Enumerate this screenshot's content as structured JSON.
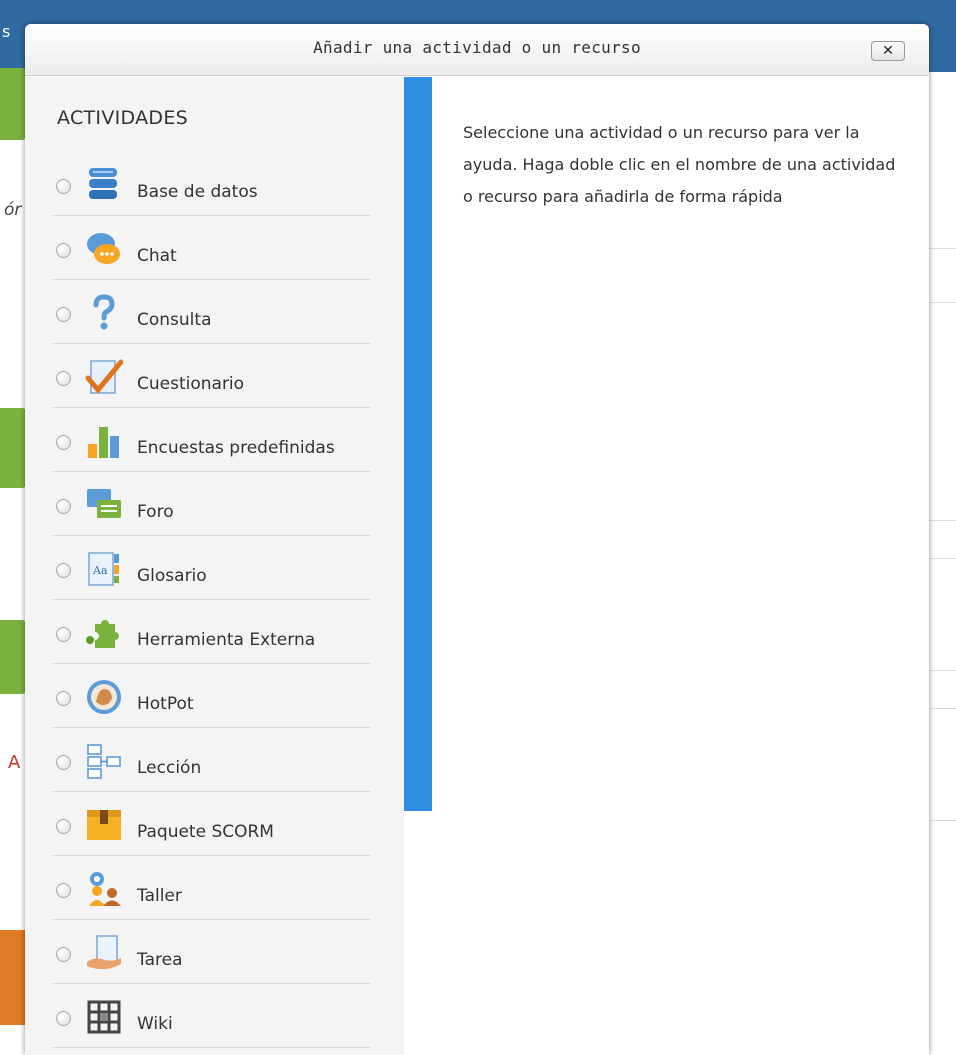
{
  "background": {
    "topbar_text": "s",
    "fragment_italic": "ór",
    "fragment_link": "A"
  },
  "dialog": {
    "title": "Añadir una actividad o un recurso",
    "close_label": "✕",
    "section_heading": "ACTIVIDADES",
    "help_text": "Seleccione una actividad o un recurso para ver la ayuda. Haga doble clic en el nombre de una actividad o recurso para añadirla de forma rápida",
    "options": [
      {
        "label": "Base de datos",
        "icon": "database-icon"
      },
      {
        "label": "Chat",
        "icon": "chat-icon"
      },
      {
        "label": "Consulta",
        "icon": "question-icon"
      },
      {
        "label": "Cuestionario",
        "icon": "quiz-check-icon"
      },
      {
        "label": "Encuestas predefinidas",
        "icon": "bar-chart-icon"
      },
      {
        "label": "Foro",
        "icon": "forum-icon"
      },
      {
        "label": "Glosario",
        "icon": "glossary-icon"
      },
      {
        "label": "Herramienta Externa",
        "icon": "puzzle-icon"
      },
      {
        "label": "HotPot",
        "icon": "hotpot-icon"
      },
      {
        "label": "Lección",
        "icon": "lesson-icon"
      },
      {
        "label": "Paquete SCORM",
        "icon": "package-icon"
      },
      {
        "label": "Taller",
        "icon": "workshop-icon"
      },
      {
        "label": "Tarea",
        "icon": "assignment-icon"
      },
      {
        "label": "Wiki",
        "icon": "wiki-icon"
      }
    ]
  },
  "colors": {
    "accent_blue": "#2f8ee0",
    "topbar": "#2f6aa0",
    "panel_bg": "#f4f4f4"
  }
}
